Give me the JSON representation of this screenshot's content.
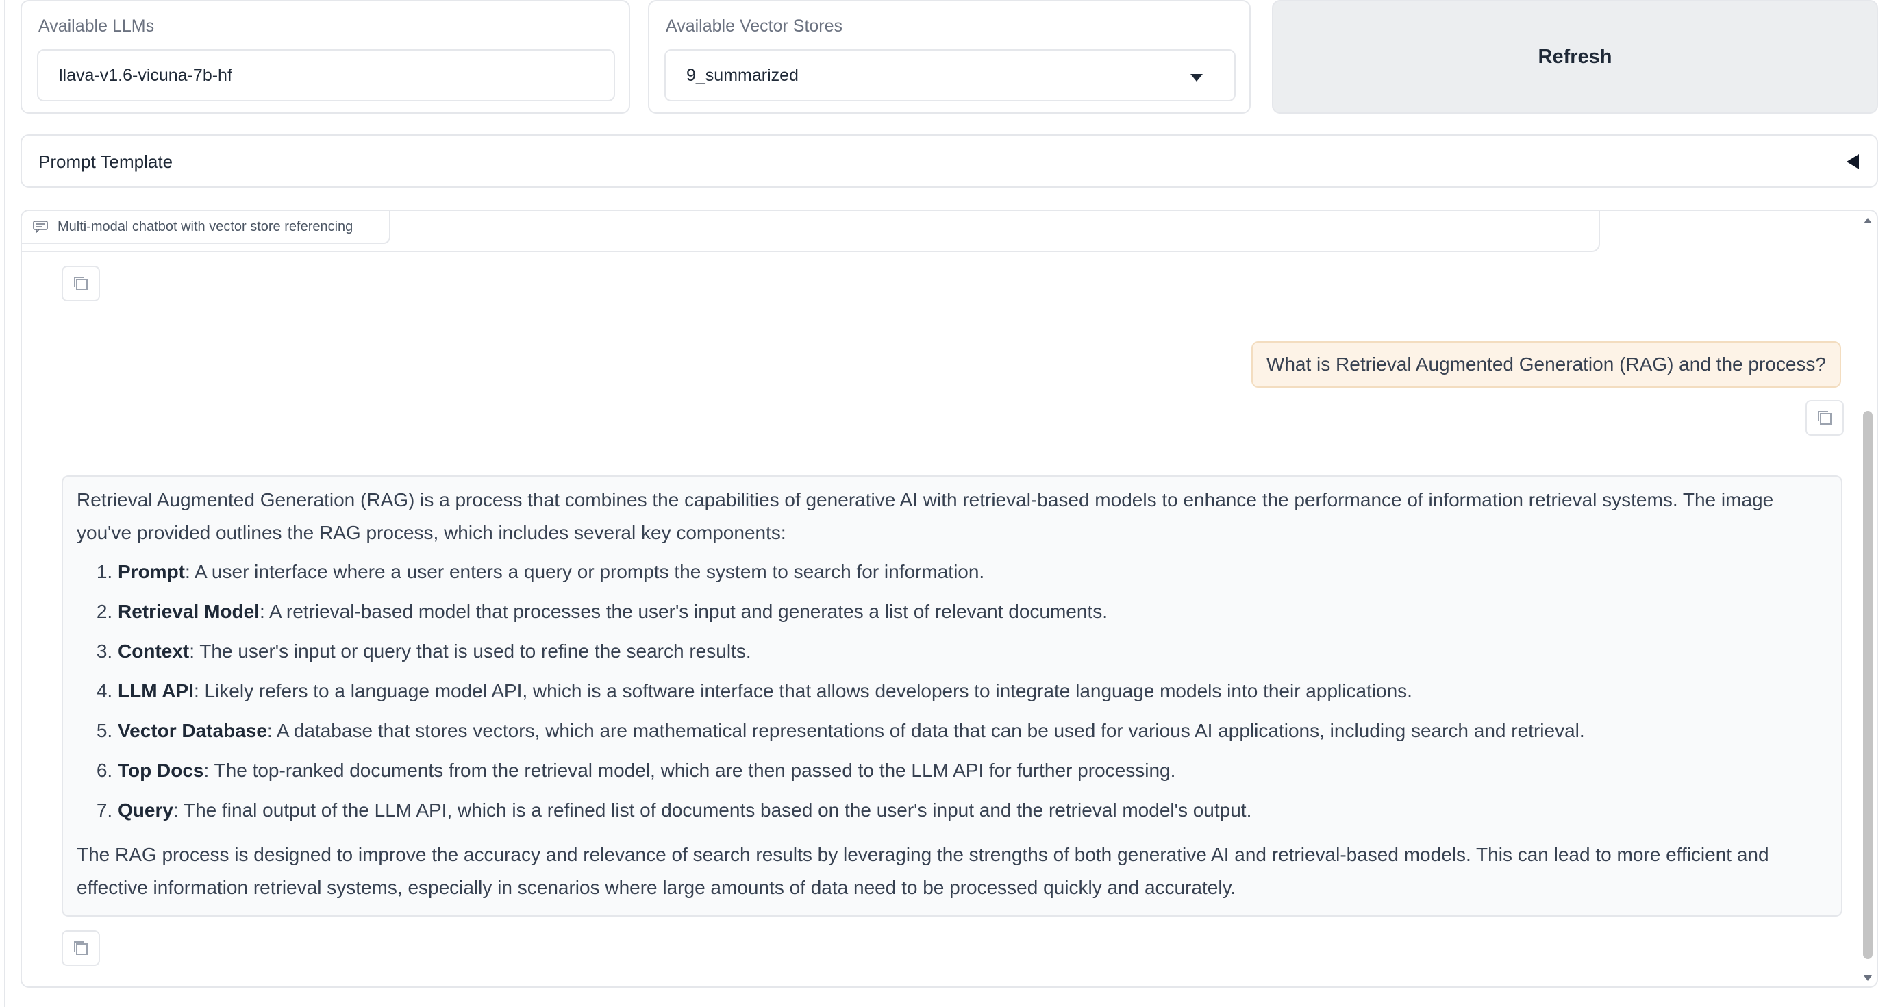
{
  "llm_panel": {
    "label": "Available LLMs",
    "value": "llava-v1.6-vicuna-7b-hf"
  },
  "vector_panel": {
    "label": "Available Vector Stores",
    "selected": "9_summarized"
  },
  "refresh_button": {
    "label": "Refresh"
  },
  "prompt_template": {
    "title": "Prompt Template"
  },
  "chatbot": {
    "label": "Multi-modal chatbot with vector store referencing",
    "user_message": "What is Retrieval Augmented Generation (RAG) and the process?",
    "bot_response": {
      "intro": "Retrieval Augmented Generation (RAG) is a process that combines the capabilities of generative AI with retrieval-based models to enhance the performance of information retrieval systems. The image you've provided outlines the RAG process, which includes several key components:",
      "items": [
        {
          "term": "Prompt",
          "text": ": A user interface where a user enters a query or prompts the system to search for information."
        },
        {
          "term": "Retrieval Model",
          "text": ": A retrieval-based model that processes the user's input and generates a list of relevant documents."
        },
        {
          "term": "Context",
          "text": ": The user's input or query that is used to refine the search results."
        },
        {
          "term": "LLM API",
          "text": ": Likely refers to a language model API, which is a software interface that allows developers to integrate language models into their applications."
        },
        {
          "term": "Vector Database",
          "text": ": A database that stores vectors, which are mathematical representations of data that can be used for various AI applications, including search and retrieval."
        },
        {
          "term": "Top Docs",
          "text": ": The top-ranked documents from the retrieval model, which are then passed to the LLM API for further processing."
        },
        {
          "term": "Query",
          "text": ": The final output of the LLM API, which is a refined list of documents based on the user's input and the retrieval model's output."
        }
      ],
      "outro": "The RAG process is designed to improve the accuracy and relevance of search results by leveraging the strengths of both generative AI and retrieval-based models. This can lead to more efficient and effective information retrieval systems, especially in scenarios where large amounts of data need to be processed quickly and accurately."
    }
  }
}
